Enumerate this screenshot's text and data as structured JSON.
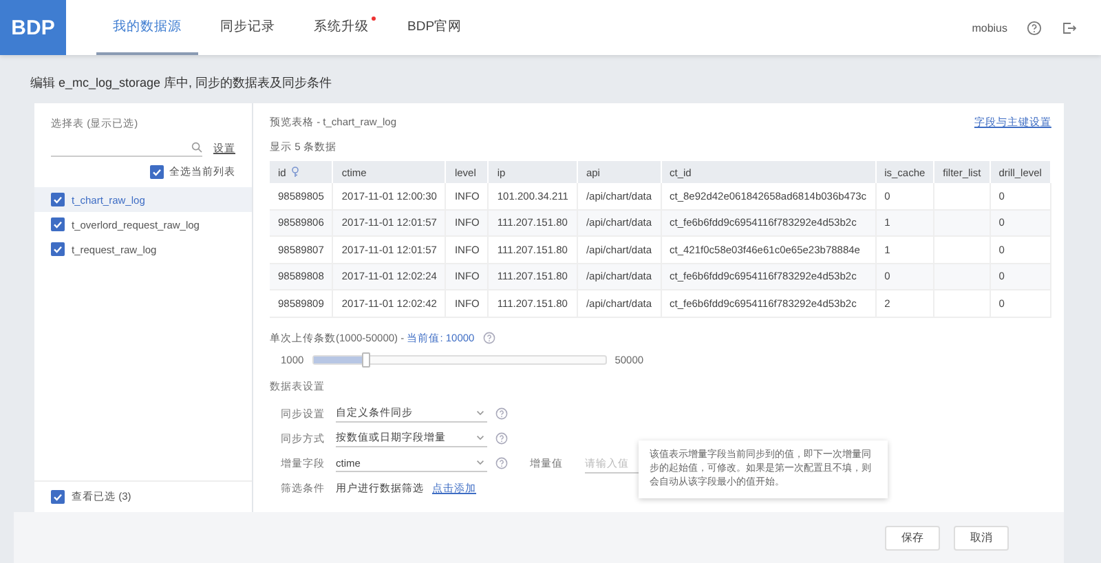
{
  "header": {
    "logo": "BDP",
    "nav": [
      {
        "label": "我的数据源",
        "selected": true,
        "badge": false
      },
      {
        "label": "同步记录",
        "selected": false,
        "badge": false
      },
      {
        "label": "系统升级",
        "selected": false,
        "badge": true
      },
      {
        "label": "BDP官网",
        "selected": false,
        "badge": false
      }
    ],
    "user": "mobius"
  },
  "page_title": "编辑 e_mc_log_storage 库中, 同步的数据表及同步条件",
  "table_picker": {
    "title": "选择表 (显示已选)",
    "settings_link": "设置",
    "select_all": {
      "label": "全选当前列表",
      "checked": true
    },
    "tables": [
      {
        "name": "t_chart_raw_log",
        "checked": true,
        "selected": true
      },
      {
        "name": "t_overlord_request_raw_log",
        "checked": true,
        "selected": false
      },
      {
        "name": "t_request_raw_log",
        "checked": true,
        "selected": false
      }
    ],
    "view_selected": {
      "label": "查看已选 (3)",
      "checked": true
    }
  },
  "preview": {
    "title": "预览表格 - t_chart_raw_log",
    "field_link": "字段与主键设置",
    "count": "显示 5 条数据",
    "columns": [
      {
        "label": "id",
        "key": true
      },
      {
        "label": "ctime",
        "key": false
      },
      {
        "label": "level",
        "key": false
      },
      {
        "label": "ip",
        "key": false
      },
      {
        "label": "api",
        "key": false
      },
      {
        "label": "ct_id",
        "key": false
      },
      {
        "label": "is_cache",
        "key": false
      },
      {
        "label": "filter_list",
        "key": false
      },
      {
        "label": "drill_level",
        "key": false
      }
    ],
    "rows": [
      [
        "98589805",
        "2017-11-01 12:00:30",
        "INFO",
        "101.200.34.211",
        "/api/chart/data",
        "ct_8e92d42e061842658ad6814b036b473c",
        "0",
        null,
        "0"
      ],
      [
        "98589806",
        "2017-11-01 12:01:57",
        "INFO",
        "111.207.151.80",
        "/api/chart/data",
        "ct_fe6b6fdd9c6954116f783292e4d53b2c",
        "1",
        null,
        "0"
      ],
      [
        "98589807",
        "2017-11-01 12:01:57",
        "INFO",
        "111.207.151.80",
        "/api/chart/data",
        "ct_421f0c58e03f46e61c0e65e23b78884e",
        "1",
        null,
        "0"
      ],
      [
        "98589808",
        "2017-11-01 12:02:24",
        "INFO",
        "111.207.151.80",
        "/api/chart/data",
        "ct_fe6b6fdd9c6954116f783292e4d53b2c",
        "0",
        null,
        "0"
      ],
      [
        "98589809",
        "2017-11-01 12:02:42",
        "INFO",
        "111.207.151.80",
        "/api/chart/data",
        "ct_fe6b6fdd9c6954116f783292e4d53b2c",
        "2",
        null,
        "0"
      ]
    ]
  },
  "upload": {
    "label": "单次上传条数(1000-50000) -",
    "current": "当前值: 10000",
    "min": "1000",
    "max": "50000",
    "level": 0.18
  },
  "table_settings": {
    "title": "数据表设置",
    "rows": [
      {
        "kind": "select",
        "label": "同步设置",
        "value": "自定义条件同步"
      },
      {
        "kind": "select",
        "label": "同步方式",
        "value": "按数值或日期字段增量"
      },
      {
        "kind": "select",
        "label": "增量字段",
        "value": "ctime",
        "extra": {
          "label": "增量值",
          "placeholder": "请输入值"
        }
      },
      {
        "kind": "filter",
        "label": "筛选条件",
        "text": "用户进行数据筛选",
        "link": "点击添加"
      }
    ],
    "tooltip": "该值表示增量字段当前同步到的值，即下一次增量同步的起始值，可修改。如果是第一次配置且不填，则会自动从该字段最小的值开始。"
  },
  "footer": {
    "buttons": [
      "保存",
      "取消"
    ]
  }
}
